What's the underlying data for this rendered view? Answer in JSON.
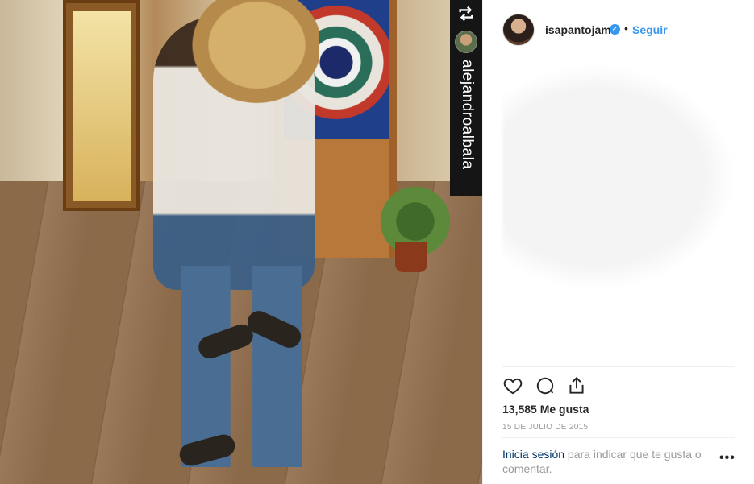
{
  "photo": {
    "repost_username": "alejandroalbala",
    "repost_icon": "repost-icon"
  },
  "header": {
    "username": "isapantojam",
    "verified_icon": "verified-badge-icon",
    "separator": "•",
    "follow_label": "Seguir"
  },
  "actions": {
    "like_icon": "heart-icon",
    "comment_icon": "comment-icon",
    "share_icon": "share-icon"
  },
  "stats": {
    "likes": "13,585 Me gusta",
    "date": "15 DE JULIO DE 2015"
  },
  "login": {
    "link_text": "Inicia sesión",
    "rest_text": " para indicar que te gusta o comentar."
  },
  "more_label": "•••",
  "colors": {
    "accent": "#3897f0",
    "text": "#262626",
    "muted": "#999999",
    "link": "#003569"
  }
}
